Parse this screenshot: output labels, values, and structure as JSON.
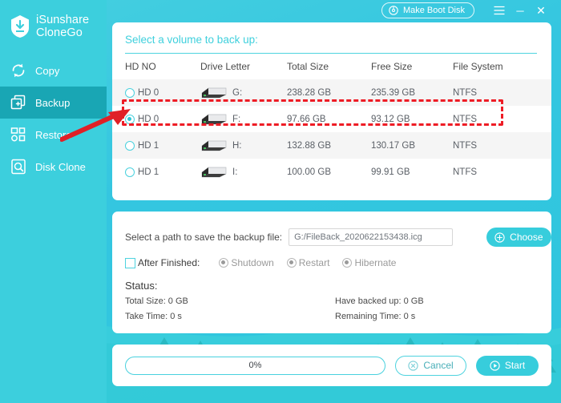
{
  "app": {
    "brand_line1": "iSunshare",
    "brand_line2": "CloneGo",
    "logo_icon": "shield-download-icon"
  },
  "titlebar": {
    "make_boot_disk": "Make Boot Disk",
    "boot_icon": "disc-icon",
    "menu_icon": "hamburger-menu-icon",
    "minimize_icon": "minimize-icon",
    "minimize_glyph": "─",
    "close_icon": "close-icon",
    "close_glyph": "✕"
  },
  "sidebar": {
    "items": [
      {
        "label": "Copy",
        "icon": "refresh-circular-icon",
        "active": false
      },
      {
        "label": "Backup",
        "icon": "copy-plus-icon",
        "active": true
      },
      {
        "label": "Restore",
        "icon": "restore-blocks-icon",
        "active": false
      },
      {
        "label": "Disk Clone",
        "icon": "disk-search-icon",
        "active": false
      }
    ]
  },
  "volumes_panel": {
    "title": "Select a volume to back up:",
    "columns": [
      "HD NO",
      "Drive Letter",
      "Total Size",
      "Free Size",
      "File System"
    ],
    "rows": [
      {
        "hd_no": "HD 0",
        "selected": false,
        "drive_letter": "G:",
        "total_size": "238.28 GB",
        "free_size": "235.39 GB",
        "file_system": "NTFS"
      },
      {
        "hd_no": "HD 0",
        "selected": true,
        "drive_letter": "F:",
        "total_size": "97.66 GB",
        "free_size": "93.12 GB",
        "file_system": "NTFS"
      },
      {
        "hd_no": "HD 1",
        "selected": false,
        "drive_letter": "H:",
        "total_size": "132.88 GB",
        "free_size": "130.17 GB",
        "file_system": "NTFS"
      },
      {
        "hd_no": "HD 1",
        "selected": false,
        "drive_letter": "I:",
        "total_size": "100.00 GB",
        "free_size": "99.91 GB",
        "file_system": "NTFS"
      }
    ],
    "highlight_row_index": 1,
    "annotation_color": "#ee1c25"
  },
  "settings_panel": {
    "path_label": "Select a path to save the backup file:",
    "path_value": "G:/FileBack_2020622153438.icg",
    "choose_label": "Choose",
    "choose_icon": "plus-circle-icon",
    "after_finished_label": "After Finished:",
    "after_finished_checked": false,
    "after_options": [
      "Shutdown",
      "Restart",
      "Hibernate"
    ],
    "status_title": "Status:",
    "status_rows": [
      {
        "left": "Total Size: 0 GB",
        "right": "Have backed up: 0 GB"
      },
      {
        "left": "Take Time: 0 s",
        "right": "Remaining Time: 0 s"
      }
    ]
  },
  "actions_panel": {
    "progress_text": "0%",
    "progress_percent": 0,
    "cancel_label": "Cancel",
    "cancel_icon": "close-circle-icon",
    "start_label": "Start",
    "start_icon": "play-circle-icon"
  },
  "colors": {
    "brand_teal": "#3ccfdd",
    "accent": "#37cddc",
    "active_nav": "#19a6b4",
    "annotation_red": "#ee1c25",
    "panel_bg": "#ffffff"
  }
}
